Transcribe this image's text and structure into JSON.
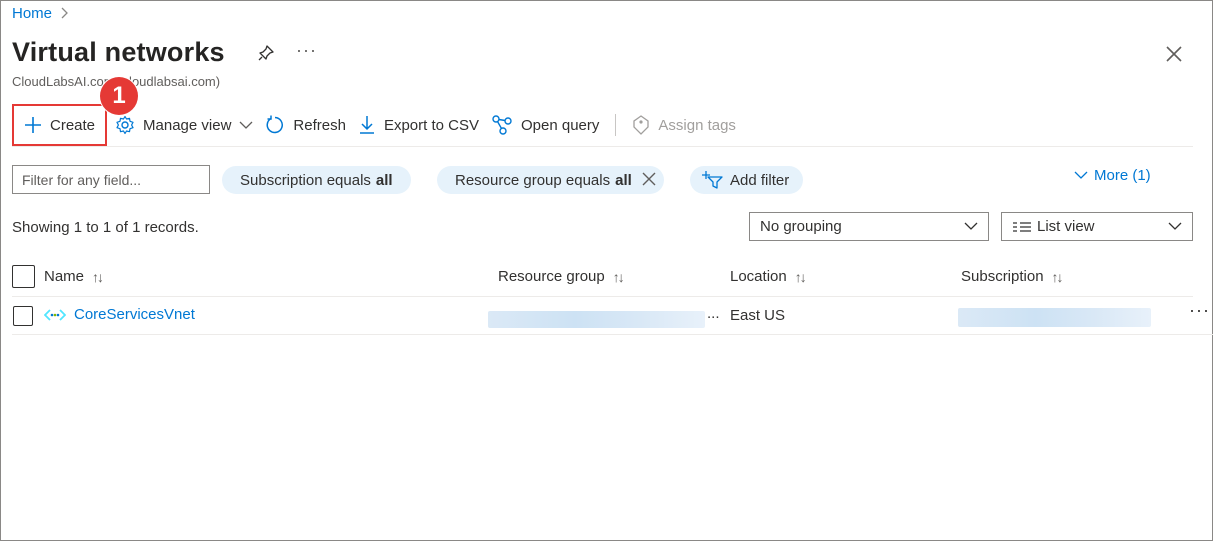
{
  "breadcrumb": {
    "home": "Home",
    "separator": ">"
  },
  "header": {
    "title": "Virtual networks",
    "subtitle": "CloudLabsAI.com (cloudlabsai.com)",
    "more": "···"
  },
  "callout": {
    "number": "1"
  },
  "toolbar": {
    "create": "Create",
    "manage_view": "Manage view",
    "refresh": "Refresh",
    "export_csv": "Export to CSV",
    "open_query": "Open query",
    "assign_tags": "Assign tags"
  },
  "filters": {
    "placeholder": "Filter for any field...",
    "subscription_prefix": "Subscription equals",
    "subscription_value": "all",
    "resource_group_prefix": "Resource group equals",
    "resource_group_value": "all",
    "add_filter": "Add filter",
    "more": "More (1)"
  },
  "records_text": "Showing 1 to 1 of 1 records.",
  "grouping": "No grouping",
  "view": "List view",
  "table": {
    "columns": [
      "Name",
      "Resource group",
      "Location",
      "Subscription"
    ],
    "rows": [
      {
        "name": "CoreServicesVnet",
        "resource_group_suffix": "...",
        "location": "East US"
      }
    ]
  },
  "colors": {
    "accent": "#0078d4",
    "highlight": "#e53935",
    "pill_bg": "#e6f2fb"
  }
}
